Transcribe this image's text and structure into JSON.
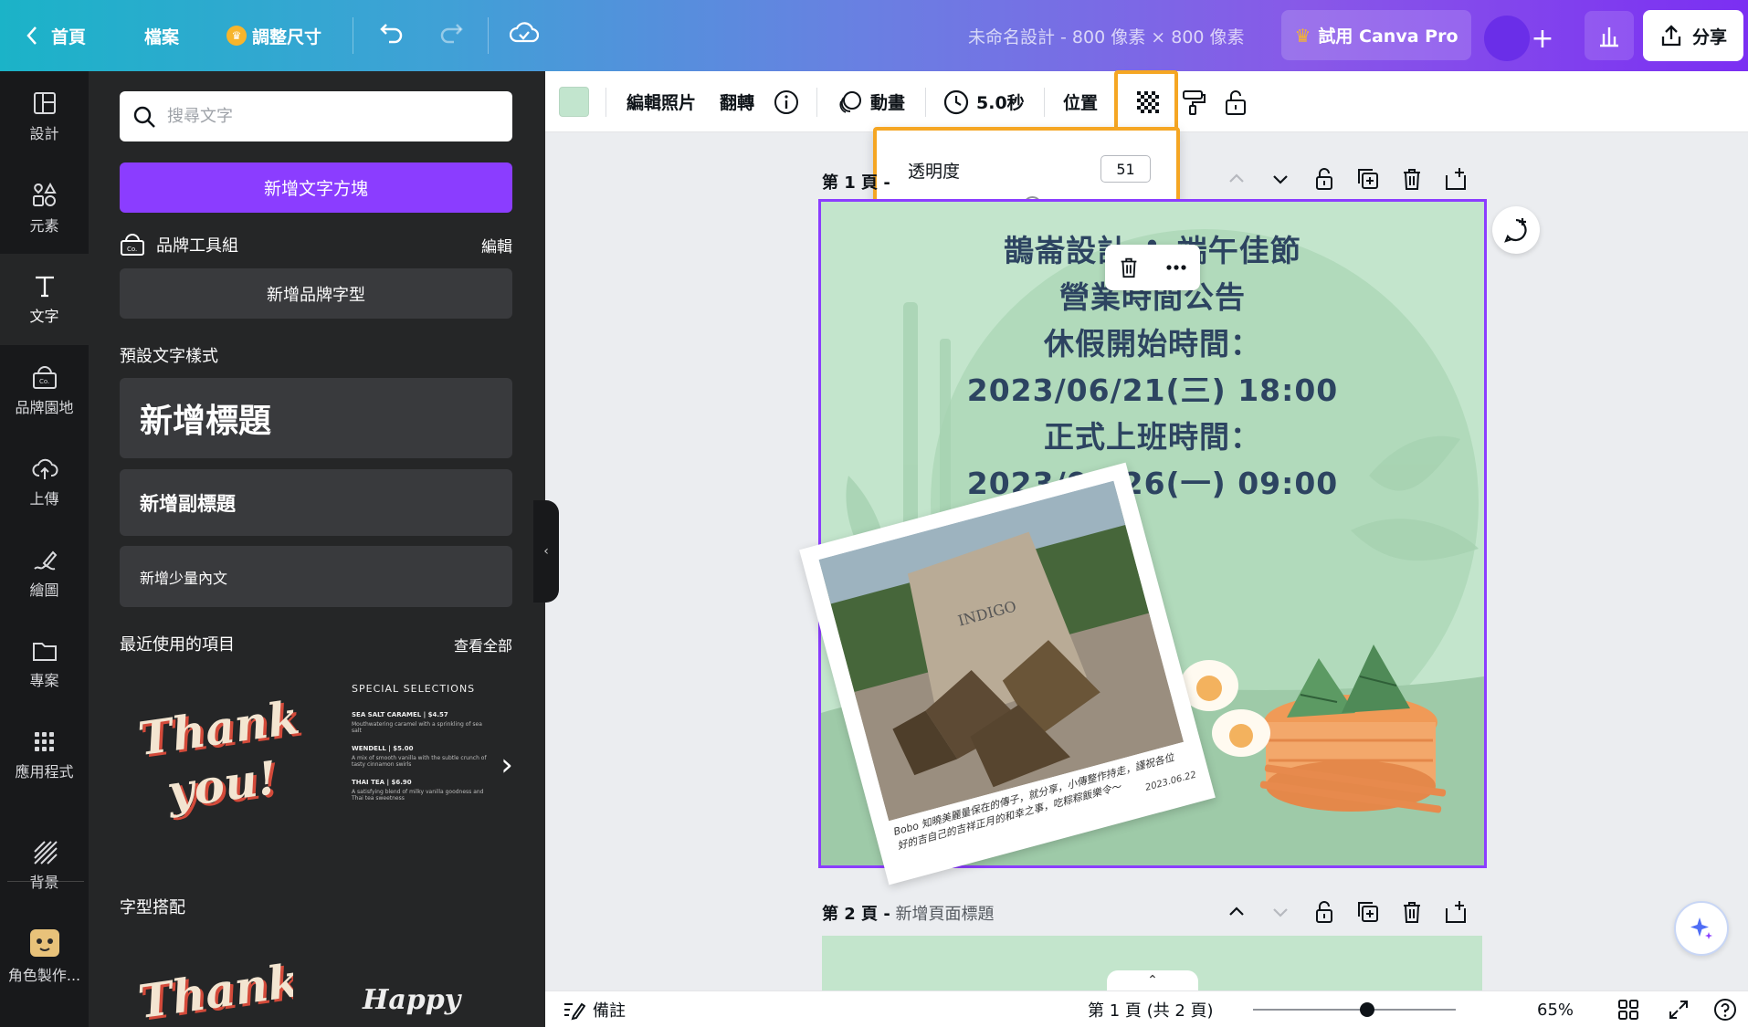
{
  "topbar": {
    "home": "首頁",
    "file": "檔案",
    "resize": "調整尺寸",
    "doc_title": "未命名設計 - 800 像素 × 800 像素",
    "pro": "試用 Canva Pro",
    "share": "分享"
  },
  "rail": {
    "items": [
      {
        "label": "設計",
        "icon": "layout-icon"
      },
      {
        "label": "元素",
        "icon": "shapes-icon"
      },
      {
        "label": "文字",
        "icon": "text-icon"
      },
      {
        "label": "品牌園地",
        "icon": "brand-icon"
      },
      {
        "label": "上傳",
        "icon": "upload-icon"
      },
      {
        "label": "繪圖",
        "icon": "draw-icon"
      },
      {
        "label": "專案",
        "icon": "folder-icon"
      },
      {
        "label": "應用程式",
        "icon": "apps-icon"
      },
      {
        "label": "背景",
        "icon": "background-icon"
      },
      {
        "label": "角色製作...",
        "icon": "character-icon"
      }
    ]
  },
  "panel": {
    "search_placeholder": "搜尋文字",
    "add_textbox": "新增文字方塊",
    "brand_kit": "品牌工具組",
    "brand_edit": "編輯",
    "add_brand_font": "新增品牌字型",
    "default_styles": "預設文字樣式",
    "heading": "新增標題",
    "subheading": "新增副標題",
    "body": "新增少量內文",
    "recent": "最近使用的項目",
    "see_all": "查看全部",
    "font_pairs": "字型搭配",
    "thumb_thankyou_1": "Thank",
    "thumb_thankyou_2": "you!",
    "thumb_menu": {
      "title": "SPECIAL SELECTIONS",
      "items": [
        {
          "name": "SEA SALT CARAMEL | $4.57",
          "desc": "Mouthwatering caramel with a sprinkling of sea salt"
        },
        {
          "name": "WENDELL | $5.00",
          "desc": "A mix of smooth vanilla with the subtle crunch of tasty cinnamon swirls"
        },
        {
          "name": "THAI TEA | $6.90",
          "desc": "A satisfying blend of milky vanilla goodness and Thai tea sweetness"
        }
      ]
    },
    "pair1": "Thank",
    "pair2": "Happy"
  },
  "context_bar": {
    "edit_photo": "編輯照片",
    "flip": "翻轉",
    "animate": "動畫",
    "duration": "5.0秒",
    "position": "位置"
  },
  "transparency": {
    "label": "透明度",
    "value": "51",
    "level": 51
  },
  "pages": {
    "page1_label": "第 1 頁 -",
    "page2_prefix": "第 2 頁 -",
    "page2_title": "新增頁面標題"
  },
  "flyer": {
    "line1": "鵲崙設計 ✿ 端午佳節",
    "line2": "營業時間公告",
    "line3": "休假開始時間：",
    "line4": "2023/06/21(三) 18:00",
    "line5": "正式上班時間：",
    "line6": "2023/06/26(一) 09:00",
    "caption": "Bobo 知曉美麗量保在的傳子，就分享，小傳整作持走，謹祝各位好的吉自己的吉祥正月的和幸之事，吃粽粽飯樂令～",
    "caption_date": "2023.06.22",
    "bag_text": "INDIGO"
  },
  "bottombar": {
    "notes": "備註",
    "page_indicator": "第 1 頁 (共 2 頁)",
    "zoom": "65%",
    "zoom_level": 65
  },
  "colors": {
    "accent": "#8b3dff",
    "highlight": "#f5a623",
    "canvas_bg": "#c3e5cc"
  }
}
